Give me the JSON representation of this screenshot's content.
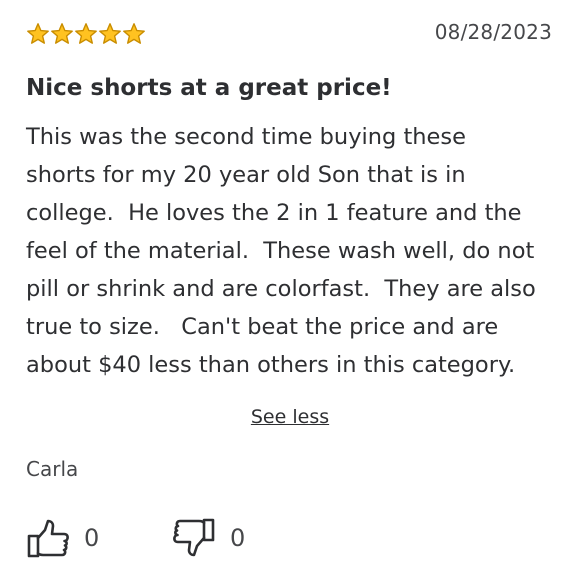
{
  "review": {
    "rating": 5,
    "rating_max": 5,
    "star_color": "#ffc220",
    "star_outline_color": "#c98d00",
    "date": "08/28/2023",
    "title": "Nice shorts at a great price!",
    "body": "This was the second time buying these\nshorts for my 20 year old Son that is in\ncollege.  He loves the 2 in 1 feature and the\nfeel of the material.  These wash well, do not\npill or shrink and are colorfast.  They are also\ntrue to size.   Can't beat the price and are\nabout $40 less than others in this category.",
    "toggle_label": "See less",
    "author": "Carla",
    "helpful": {
      "up_icon": "thumbs-up-icon",
      "up_count": "0",
      "down_icon": "thumbs-down-icon",
      "down_count": "0"
    }
  }
}
